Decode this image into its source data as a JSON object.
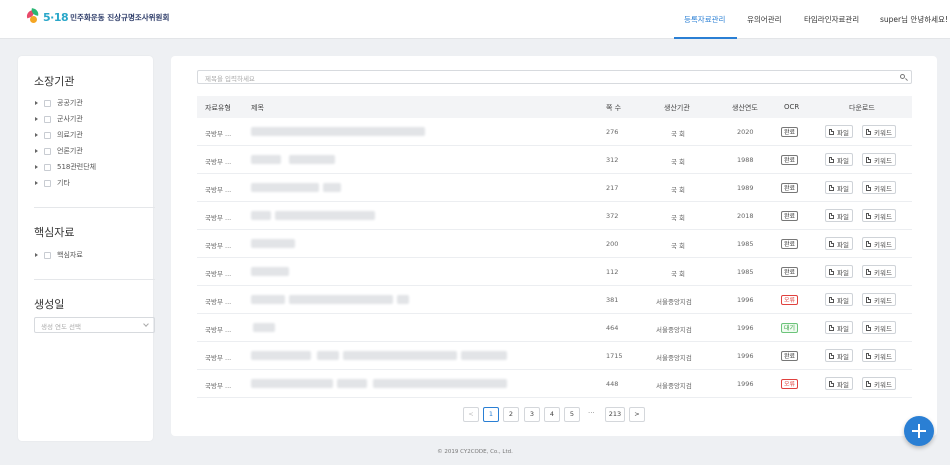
{
  "header": {
    "logo_number": "5·18",
    "logo_text": "민주화운동 진상규명조사위원회",
    "nav": [
      {
        "label": "등록자료관리",
        "active": true
      },
      {
        "label": "유의어관리",
        "active": false
      },
      {
        "label": "타임라인자료관리",
        "active": false
      },
      {
        "label": "super님 안녕하세요!",
        "active": false
      }
    ]
  },
  "sidebar": {
    "org_title": "소장기관",
    "orgs": [
      "공공기관",
      "군사기관",
      "의료기관",
      "언론기관",
      "518관련단체",
      "기타"
    ],
    "core_title": "핵심자료",
    "core_items": [
      "핵심자료"
    ],
    "date_title": "생성일",
    "year_placeholder": "생성 연도 선택"
  },
  "search": {
    "placeholder": "제목을 입력하세요"
  },
  "table": {
    "headers": {
      "type": "자료유형",
      "title": "제목",
      "pages": "쪽 수",
      "org": "생산기관",
      "year": "생산연도",
      "ocr": "OCR",
      "download": "다운로드"
    },
    "file_label": "파일",
    "keyword_label": "키워드",
    "rows": [
      {
        "type": "국방부 ...",
        "pages": "276",
        "org": "국 회",
        "year": "2020",
        "ocr": "완료",
        "ocr_status": "done"
      },
      {
        "type": "국방부 ...",
        "pages": "312",
        "org": "국 회",
        "year": "1988",
        "ocr": "완료",
        "ocr_status": "done"
      },
      {
        "type": "국방부 ...",
        "pages": "217",
        "org": "국 회",
        "year": "1989",
        "ocr": "완료",
        "ocr_status": "done"
      },
      {
        "type": "국방부 ...",
        "pages": "372",
        "org": "국 회",
        "year": "2018",
        "ocr": "완료",
        "ocr_status": "done"
      },
      {
        "type": "국방부 ...",
        "pages": "200",
        "org": "국 회",
        "year": "1985",
        "ocr": "완료",
        "ocr_status": "done"
      },
      {
        "type": "국방부 ...",
        "pages": "112",
        "org": "국 회",
        "year": "1985",
        "ocr": "완료",
        "ocr_status": "done"
      },
      {
        "type": "국방부 ...",
        "pages": "381",
        "org": "서울중앙지검",
        "year": "1996",
        "ocr": "오류",
        "ocr_status": "error"
      },
      {
        "type": "국방부 ...",
        "pages": "464",
        "org": "서울중앙지검",
        "year": "1996",
        "ocr": "대기",
        "ocr_status": "waiting"
      },
      {
        "type": "국방부 ...",
        "pages": "1715",
        "org": "서울중앙지검",
        "year": "1996",
        "ocr": "완료",
        "ocr_status": "done"
      },
      {
        "type": "국방부 ...",
        "pages": "448",
        "org": "서울중앙지검",
        "year": "1996",
        "ocr": "오류",
        "ocr_status": "error"
      }
    ]
  },
  "pagination": {
    "prev": "<",
    "pages": [
      "1",
      "2",
      "3",
      "4",
      "5"
    ],
    "ellipsis": "···",
    "last": "213",
    "next": ">",
    "current": "1"
  },
  "footer": "© 2019 CY2CODE, Co., Ltd.",
  "colors": {
    "accent": "#2a7fd4",
    "error": "#e0413e",
    "waiting": "#3aa545"
  },
  "icons": {
    "search": "search-icon",
    "add": "plus-icon",
    "file": "document-icon"
  }
}
